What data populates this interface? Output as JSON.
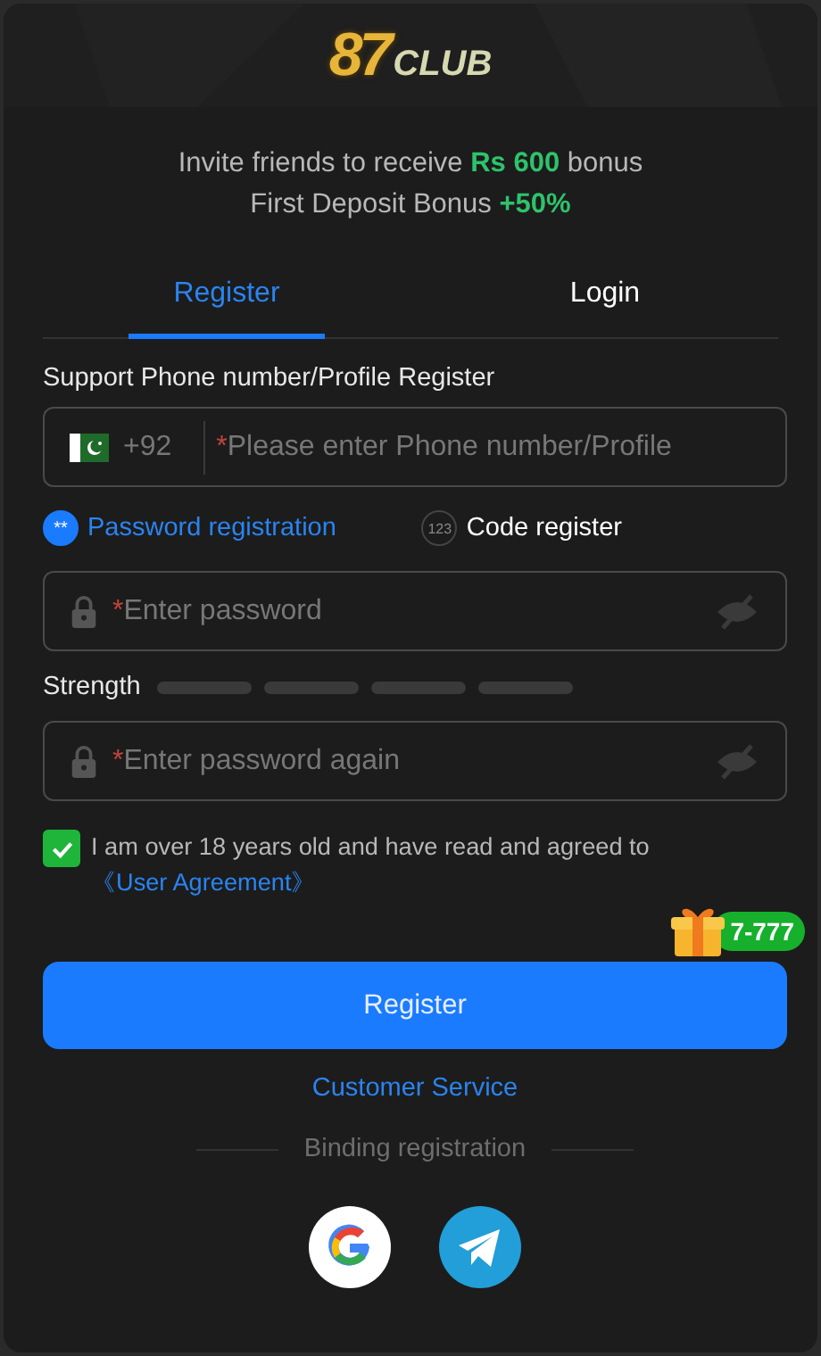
{
  "logo": {
    "number": "87",
    "name": "CLUB"
  },
  "promo": [
    "Invite friends to receive **Rs 600** bonus",
    "First Deposit Bonus **+50%**"
  ],
  "tabs": [
    {
      "label": "Register",
      "selected": true
    },
    {
      "label": "Login",
      "selected": false
    }
  ],
  "phone": {
    "label": "Support Phone number/Profile Register",
    "country_code": "+92",
    "required_mark": "*",
    "placeholder": "Please enter Phone number/Profile"
  },
  "methods": [
    {
      "icon_text": "**",
      "label": "Password registration",
      "selected": true
    },
    {
      "icon_text": "123",
      "label": "Code register",
      "selected": false
    }
  ],
  "password": {
    "required_mark": "*",
    "placeholder": "Enter password"
  },
  "strength": {
    "label": "Strength"
  },
  "confirm": {
    "required_mark": "*",
    "placeholder": "Enter password again"
  },
  "agreement": {
    "checked": true,
    "text": "I am over 18 years old and have read and agreed to",
    "link": "《User Agreement》"
  },
  "gift_badge": "7-777",
  "register_button": "Register",
  "customer_service": "Customer Service",
  "binding_label": "Binding registration",
  "social": [
    {
      "kind": "google"
    },
    {
      "kind": "telegram"
    }
  ]
}
